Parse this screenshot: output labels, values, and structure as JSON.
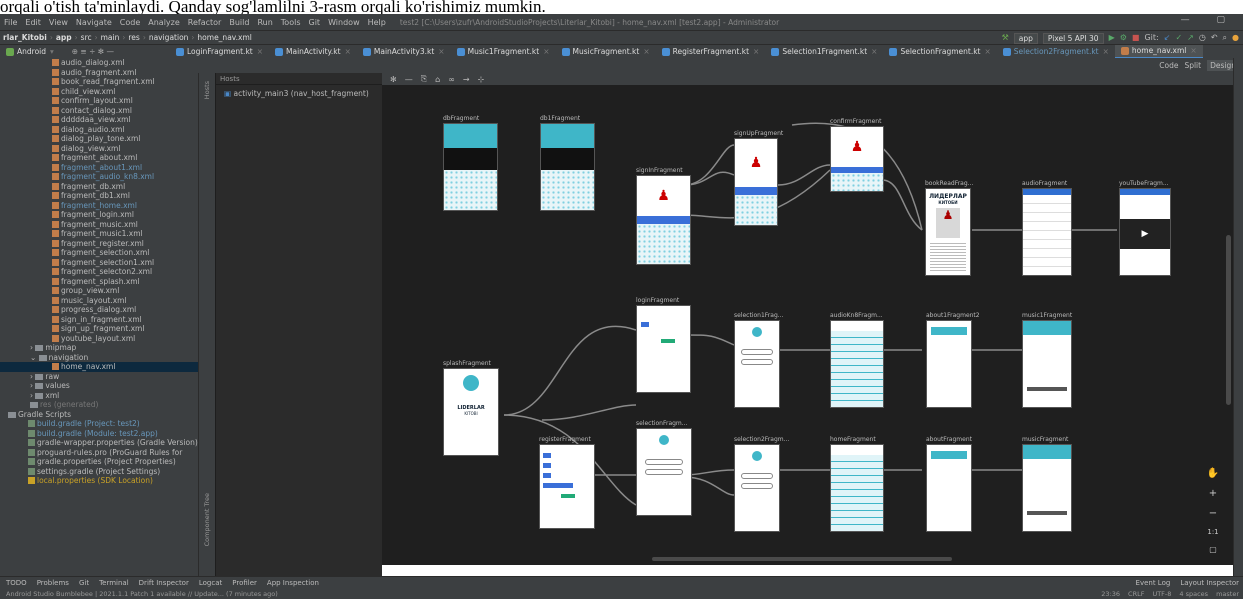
{
  "caption": "orqali o'tish ta'minlaydi. Qanday sog'lamlilni 3-rasm orqali ko'rishimiz mumkin.",
  "menu": [
    "File",
    "Edit",
    "View",
    "Navigate",
    "Code",
    "Analyze",
    "Refactor",
    "Build",
    "Run",
    "Tools",
    "Git",
    "Window",
    "Help"
  ],
  "window_title": "test2 [C:\\Users\\zufr\\AndroidStudioProjects\\Literlar_Kitobi] - home_nav.xml [test2.app] - Administrator",
  "breadcrumbs": [
    "rlar_Kitobi",
    "app",
    "src",
    "main",
    "res",
    "navigation",
    "home_nav.xml"
  ],
  "run_config": "app",
  "device": "Pixel 5 API 30",
  "git_label": "Git:",
  "project_view": "Android",
  "tabs": [
    "LoginFragment.kt",
    "MainActivity.kt",
    "MainActivity3.kt",
    "Music1Fragment.kt",
    "MusicFragment.kt",
    "RegisterFragment.kt",
    "Selection1Fragment.kt",
    "SelectionFragment.kt",
    "Selection2Fragment.kt",
    "home_nav.xml"
  ],
  "view_modes": {
    "code": "Code",
    "split": "Split",
    "design": "Design"
  },
  "tree": [
    {
      "t": "audio_dialog.xml",
      "k": "f"
    },
    {
      "t": "audio_fragment.xml",
      "k": "f"
    },
    {
      "t": "book_read_fragment.xml",
      "k": "f"
    },
    {
      "t": "child_view.xml",
      "k": "f"
    },
    {
      "t": "confirm_layout.xml",
      "k": "f"
    },
    {
      "t": "contact_dialog.xml",
      "k": "f"
    },
    {
      "t": "dddddaa_view.xml",
      "k": "f"
    },
    {
      "t": "dialog_audio.xml",
      "k": "f"
    },
    {
      "t": "dialog_play_tone.xml",
      "k": "f"
    },
    {
      "t": "dialog_view.xml",
      "k": "f"
    },
    {
      "t": "fragment_about.xml",
      "k": "f"
    },
    {
      "t": "fragment_about1.xml",
      "k": "f",
      "blue": true
    },
    {
      "t": "fragment_audio_kn8.xml",
      "k": "f",
      "blue": true
    },
    {
      "t": "fragment_db.xml",
      "k": "f"
    },
    {
      "t": "fragment_db1.xml",
      "k": "f"
    },
    {
      "t": "fragment_home.xml",
      "k": "f",
      "blue": true
    },
    {
      "t": "fragment_login.xml",
      "k": "f"
    },
    {
      "t": "fragment_music.xml",
      "k": "f"
    },
    {
      "t": "fragment_music1.xml",
      "k": "f"
    },
    {
      "t": "fragment_register.xml",
      "k": "f"
    },
    {
      "t": "fragment_selection.xml",
      "k": "f"
    },
    {
      "t": "fragment_selection1.xml",
      "k": "f"
    },
    {
      "t": "fragment_selecton2.xml",
      "k": "f"
    },
    {
      "t": "fragment_splash.xml",
      "k": "f"
    },
    {
      "t": "group_view.xml",
      "k": "f"
    },
    {
      "t": "music_layout.xml",
      "k": "f"
    },
    {
      "t": "progress_dialog.xml",
      "k": "f"
    },
    {
      "t": "sign_in_fragment.xml",
      "k": "f"
    },
    {
      "t": "sign_up_fragment.xml",
      "k": "f"
    },
    {
      "t": "youtube_layout.xml",
      "k": "f"
    },
    {
      "t": "mipmap",
      "k": "d"
    },
    {
      "t": "navigation",
      "k": "d",
      "open": true
    },
    {
      "t": "home_nav.xml",
      "k": "f",
      "sel": true
    },
    {
      "t": "raw",
      "k": "d"
    },
    {
      "t": "values",
      "k": "d"
    },
    {
      "t": "xml",
      "k": "d"
    },
    {
      "t": "res (generated)",
      "k": "g"
    },
    {
      "t": "Gradle Scripts",
      "k": "s"
    },
    {
      "t": "build.gradle (Project: test2)",
      "k": "gr",
      "blue": true
    },
    {
      "t": "build.gradle (Module: test2.app)",
      "k": "gr",
      "blue": true
    },
    {
      "t": "gradle-wrapper.properties (Gradle Version)",
      "k": "gr"
    },
    {
      "t": "proguard-rules.pro (ProGuard Rules for",
      "k": "gr"
    },
    {
      "t": "gradle.properties (Project Properties)",
      "k": "gr"
    },
    {
      "t": "settings.gradle (Project Settings)",
      "k": "gr"
    },
    {
      "t": "local.properties (SDK Location)",
      "k": "gr",
      "warn": true
    }
  ],
  "host_panel": {
    "title": "Hosts",
    "item": "activity_main3 (nav_host_fragment)"
  },
  "side_labels": {
    "hosts": "Hosts",
    "component_tree": "Component Tree"
  },
  "fragments": {
    "db": "dbFragment",
    "db1": "db1Fragment",
    "signIn": "signInFragment",
    "signUp": "signUpFragment",
    "confirm": "confirmFragment",
    "bookRead": "bookReadFrag...",
    "audio": "audioFragment",
    "youtube": "youTubeFragm...",
    "login": "loginFragment",
    "splash": "splashFragment",
    "selection1": "selection1Frag...",
    "audioKn8": "audioKn8Fragm...",
    "about1": "about1Fragment2",
    "music1": "music1Fragment",
    "register": "registerFragment",
    "selection": "selectionFragm...",
    "selection2": "selection2Fragm...",
    "home": "homeFragment",
    "about": "aboutFragment",
    "music": "musicFragment"
  },
  "screen_text": {
    "liderlar": "ЛИДЕРЛАР",
    "kitobi": "КИТОБИ",
    "splash_title": "LIDERLAR",
    "splash_sub": "KITOBI"
  },
  "bottom_tools": [
    "TODO",
    "Problems",
    "Git",
    "Terminal",
    "Drift Inspector",
    "Logcat",
    "Profiler",
    "App Inspection"
  ],
  "bottom_right": [
    "Event Log",
    "Layout Inspector"
  ],
  "status": "Android Studio Bumblebee | 2021.1.1 Patch 1 available // Update... (7 minutes ago)",
  "status_right": [
    "23:36",
    "CRLF",
    "UTF-8",
    "4 spaces",
    "master"
  ]
}
